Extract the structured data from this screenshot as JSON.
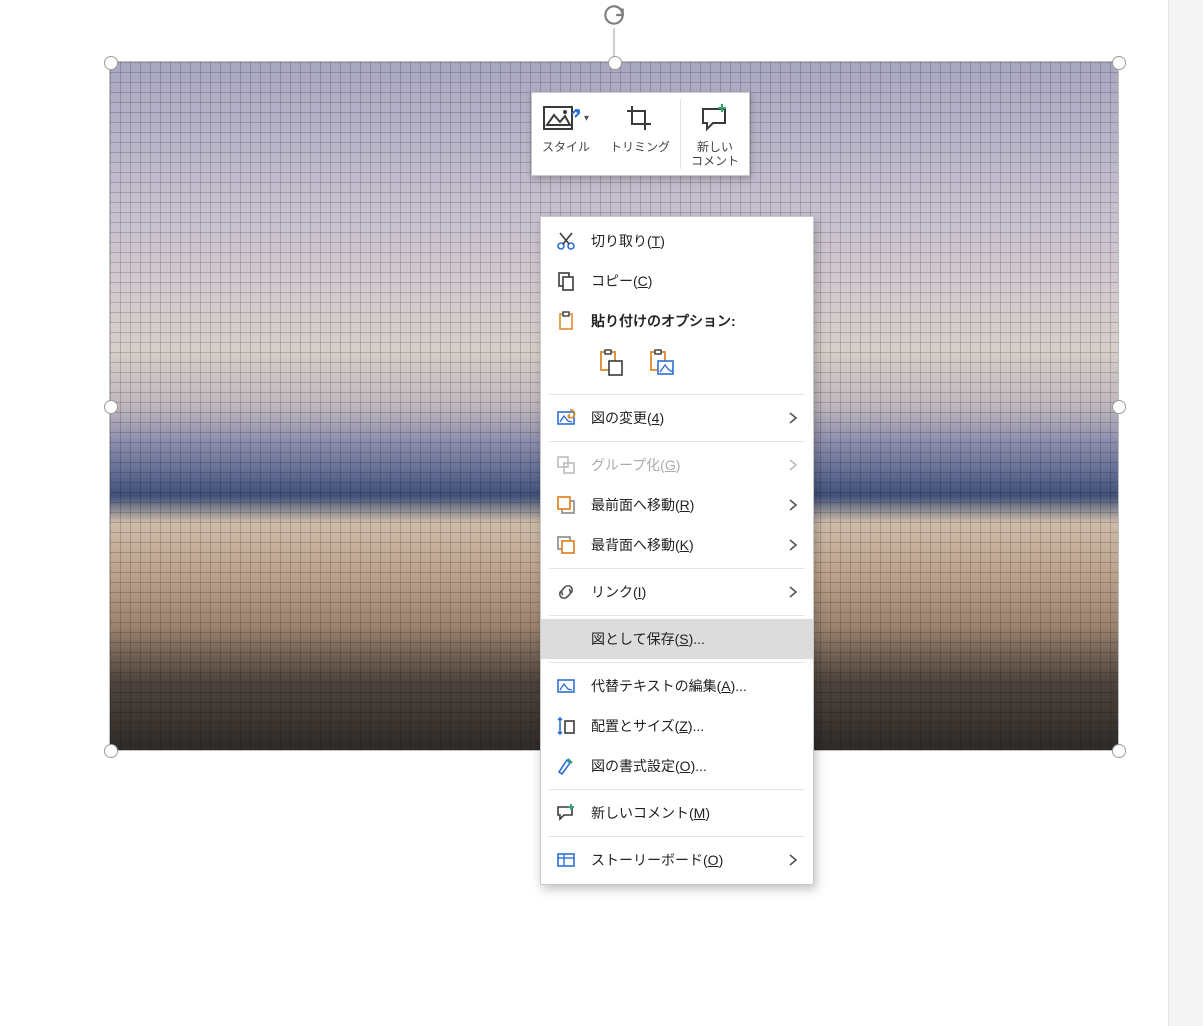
{
  "mini_toolbar": {
    "style": "スタイル",
    "trim": "トリミング",
    "comment": "新しい\nコメント"
  },
  "context_menu": {
    "cut": {
      "pre": "切り取り(",
      "u": "T",
      "post": ")"
    },
    "copy": {
      "pre": "コピー(",
      "u": "C",
      "post": ")"
    },
    "paste_header": "貼り付けのオプション:",
    "change_pic": {
      "pre": "図の変更(",
      "u": "4",
      "post": ")"
    },
    "group": {
      "pre": "グループ化(",
      "u": "G",
      "post": ")"
    },
    "bring_front": {
      "pre": "最前面へ移動(",
      "u": "R",
      "post": ")"
    },
    "send_back": {
      "pre": "最背面へ移動(",
      "u": "K",
      "post": ")"
    },
    "link": {
      "pre": "リンク(",
      "u": "I",
      "post": ")"
    },
    "save_as_pic": {
      "pre": "図として保存(",
      "u": "S",
      "post": ")..."
    },
    "alt_text": {
      "pre": "代替テキストの編集(",
      "u": "A",
      "post": ")..."
    },
    "size_pos": {
      "pre": "配置とサイズ(",
      "u": "Z",
      "post": ")..."
    },
    "format_pic": {
      "pre": "図の書式設定(",
      "u": "O",
      "post": ")..."
    },
    "new_comment": {
      "pre": "新しいコメント(",
      "u": "M",
      "post": ")"
    },
    "storyboard": {
      "pre": "ストーリーボード(",
      "u": "O",
      "post": ")"
    }
  }
}
